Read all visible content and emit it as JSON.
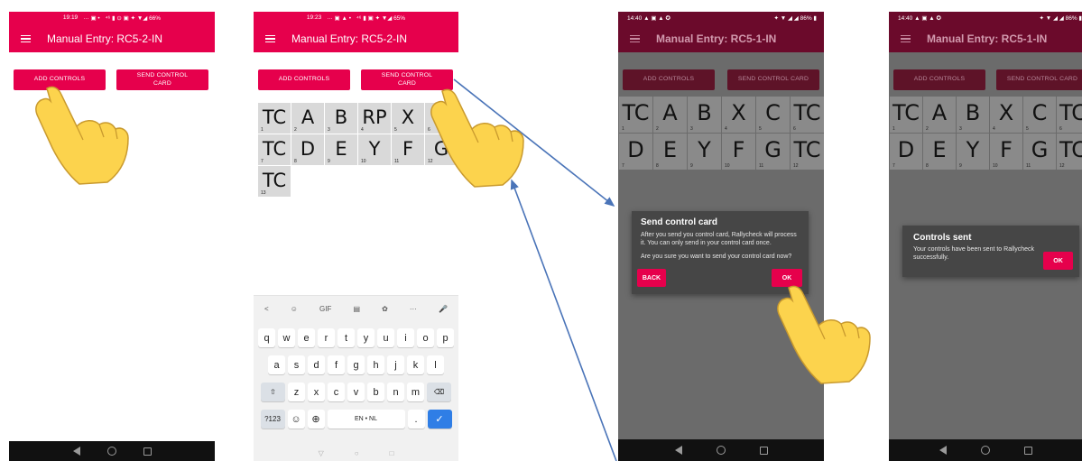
{
  "colors": {
    "accent": "#e6004c",
    "accent_dark_bar": "#6b0a2b",
    "accent_dim_button": "#5e1328",
    "dialog_bg": "#464646",
    "arrow": "#4a74b8",
    "hand": "#fcd34d"
  },
  "phone1": {
    "status": {
      "time": "19:19",
      "icons": "··· ▣ •",
      "right": "⁴⁶ ▮ ⊙ ▣ ✦ ▼◢ 66%"
    },
    "title": "Manual Entry: RC5-2-IN",
    "add_controls": "ADD CONTROLS",
    "send_card": [
      "SEND CONTROL",
      "CARD"
    ]
  },
  "phone2": {
    "status": {
      "time": "19:23",
      "icons": "··· ▣ ▲ •",
      "right": "⁴⁶ ▮ ▣ ✦ ▼◢ 65%"
    },
    "title": "Manual Entry: RC5-2-IN",
    "add_controls": "ADD CONTROLS",
    "send_card": [
      "SEND CONTROL",
      "CARD"
    ],
    "cells": [
      {
        "code": "TC",
        "num": "1"
      },
      {
        "code": "A",
        "num": "2"
      },
      {
        "code": "B",
        "num": "3"
      },
      {
        "code": "RP",
        "num": "4"
      },
      {
        "code": "X",
        "num": "5"
      },
      {
        "code": "C",
        "num": "6"
      },
      {
        "code": "TC",
        "num": "7"
      },
      {
        "code": "D",
        "num": "8"
      },
      {
        "code": "E",
        "num": "9"
      },
      {
        "code": "Y",
        "num": "10"
      },
      {
        "code": "F",
        "num": "11"
      },
      {
        "code": "G",
        "num": "12"
      },
      {
        "code": "TC",
        "num": "13"
      }
    ],
    "keyboard": {
      "tools": [
        "<",
        "☺",
        "GIF",
        "▤",
        "✿",
        "···",
        "🎤"
      ],
      "row1": [
        "q",
        "w",
        "e",
        "r",
        "t",
        "y",
        "u",
        "i",
        "o",
        "p"
      ],
      "row2": [
        "a",
        "s",
        "d",
        "f",
        "g",
        "h",
        "j",
        "k",
        "l"
      ],
      "row3": [
        "z",
        "x",
        "c",
        "v",
        "b",
        "n",
        "m"
      ],
      "shift": "⇧",
      "backspace": "⌫",
      "symbols": "?123",
      "emoji": "☺",
      "globe": "⊕",
      "space": "EN • NL",
      "period": ".",
      "enter": "✓",
      "nav": [
        "▽",
        "○",
        "□"
      ]
    }
  },
  "phone3": {
    "status": {
      "time": "14:40",
      "icons": "▲ ▣ ▲ ✪",
      "right": "✦ ▼ ◢ ◢ 86% ▮"
    },
    "title": "Manual Entry: RC5-1-IN",
    "add_controls": "ADD CONTROLS",
    "send_card": "SEND CONTROL CARD",
    "cells": [
      {
        "code": "TC",
        "num": "1"
      },
      {
        "code": "A",
        "num": "2"
      },
      {
        "code": "B",
        "num": "3"
      },
      {
        "code": "X",
        "num": "4"
      },
      {
        "code": "C",
        "num": "5"
      },
      {
        "code": "TC",
        "num": "6"
      },
      {
        "code": "D",
        "num": "7"
      },
      {
        "code": "E",
        "num": "8"
      },
      {
        "code": "Y",
        "num": "9"
      },
      {
        "code": "F",
        "num": "10"
      },
      {
        "code": "G",
        "num": "11"
      },
      {
        "code": "TC",
        "num": "12"
      }
    ],
    "dialog": {
      "title": "Send control card",
      "body1": "After you send you control card, Rallycheck will process it. You can only send in your control card once.",
      "body2": "Are you sure you want to send your control card now?",
      "back": "BACK",
      "ok": "OK"
    }
  },
  "phone4": {
    "status": {
      "time": "14:40",
      "icons": "▲ ▣ ▲ ✪",
      "right": "✦ ▼ ◢ ◢ 86% ▮"
    },
    "title": "Manual Entry: RC5-1-IN",
    "add_controls": "ADD CONTROLS",
    "send_card": "SEND CONTROL CARD",
    "cells": [
      {
        "code": "TC",
        "num": "1"
      },
      {
        "code": "A",
        "num": "2"
      },
      {
        "code": "B",
        "num": "3"
      },
      {
        "code": "X",
        "num": "4"
      },
      {
        "code": "C",
        "num": "5"
      },
      {
        "code": "TC",
        "num": "6"
      },
      {
        "code": "D",
        "num": "7"
      },
      {
        "code": "E",
        "num": "8"
      },
      {
        "code": "Y",
        "num": "9"
      },
      {
        "code": "F",
        "num": "10"
      },
      {
        "code": "G",
        "num": "11"
      },
      {
        "code": "TC",
        "num": "12"
      }
    ],
    "dialog": {
      "title": "Controls sent",
      "body": "Your controls have been sent to Rallycheck successfully.",
      "ok": "OK"
    }
  },
  "nav": [
    "◁",
    "○",
    "□"
  ]
}
